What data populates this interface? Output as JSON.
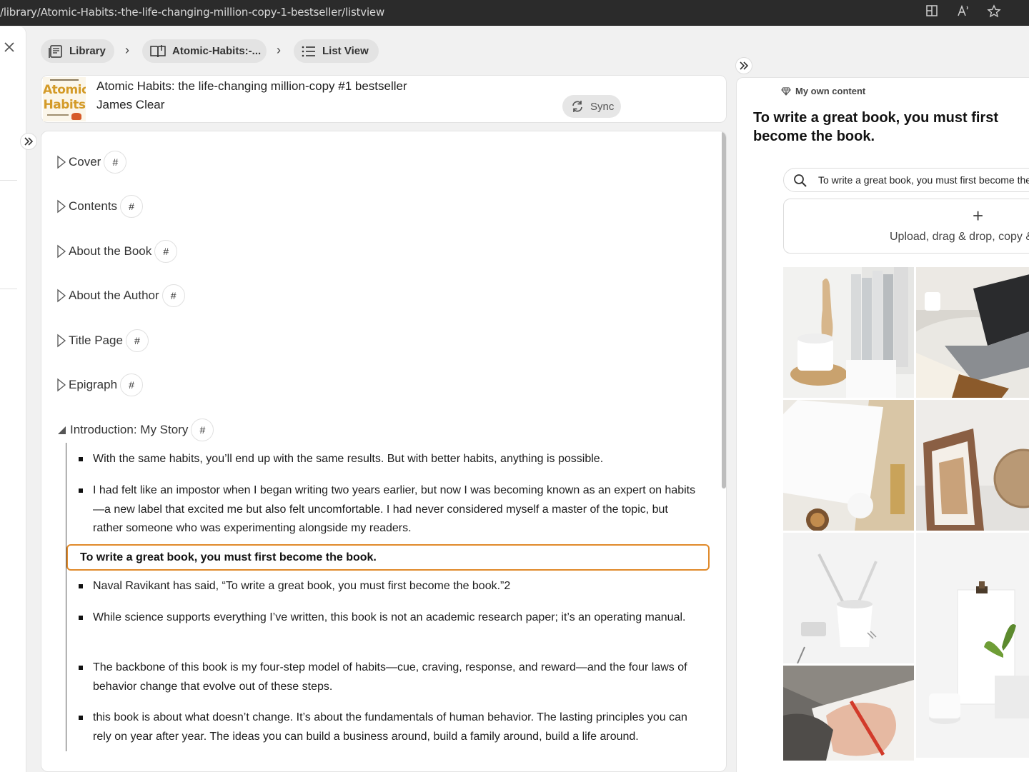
{
  "browser": {
    "url": "/library/Atomic-Habits:-the-life-changing-million-copy-1-bestseller/listview"
  },
  "breadcrumb": {
    "library_label": "Library",
    "book_label": "Atomic-Habits:-...",
    "view_label": "List View"
  },
  "book": {
    "title": "Atomic Habits: the life-changing million-copy #1 bestseller",
    "author": "James Clear",
    "cover_line1": "Atomic",
    "cover_line2": "Habits",
    "sync_label": "Sync"
  },
  "toc": {
    "hash_label": "#",
    "items": [
      {
        "label": "Cover"
      },
      {
        "label": "Contents"
      },
      {
        "label": "About the Book"
      },
      {
        "label": "About the Author"
      },
      {
        "label": "Title Page"
      },
      {
        "label": "Epigraph"
      },
      {
        "label": "Introduction: My Story"
      }
    ]
  },
  "highlights": [
    "With the same habits, you’ll end up with the same results. But with better habits, anything is possible.",
    "I had felt like an impostor when I began writing two years earlier, but now I was becoming known as an expert on habits—a new label that excited me but also felt uncomfortable. I had never considered myself a master of the topic, but rather someone who was experimenting alongside my readers.",
    "To write a great book, you must first become the book.",
    "Naval Ravikant has said, “To write a great book, you must first become the book.”2",
    "While science supports everything I’ve written, this book is not an academic research paper; it’s an operating manual.",
    "The backbone of this book is my four-step model of habits—cue, craving, response, and reward—and the four laws of behavior change that evolve out of these steps.",
    "this book is about what doesn’t change. It’s about the fundamentals of human behavior. The lasting principles you can rely on year after year. The ideas you can build a business around, build a family around, build a life around."
  ],
  "right_panel": {
    "own_content_label": "My own content",
    "quote": "To write a great book, you must first become the book.",
    "search_value": "To write a great book, you must first become the book.",
    "upload_label": "Upload, drag & drop, copy & paste",
    "plus_label": "+"
  },
  "colors": {
    "highlight_border": "#e08a2b",
    "cover_text": "#d49b29",
    "panel_bg": "#ffffff",
    "page_bg": "#f1f1f1"
  },
  "icons": {
    "close": "close-icon",
    "expand": "double-chevron-right-icon",
    "library": "library-icon",
    "book": "open-book-icon",
    "list": "list-icon",
    "sync": "sync-icon",
    "search": "search-icon",
    "gem": "gem-icon",
    "triangle_collapsed": "triangle-right-icon",
    "triangle_expanded": "triangle-down-icon"
  }
}
